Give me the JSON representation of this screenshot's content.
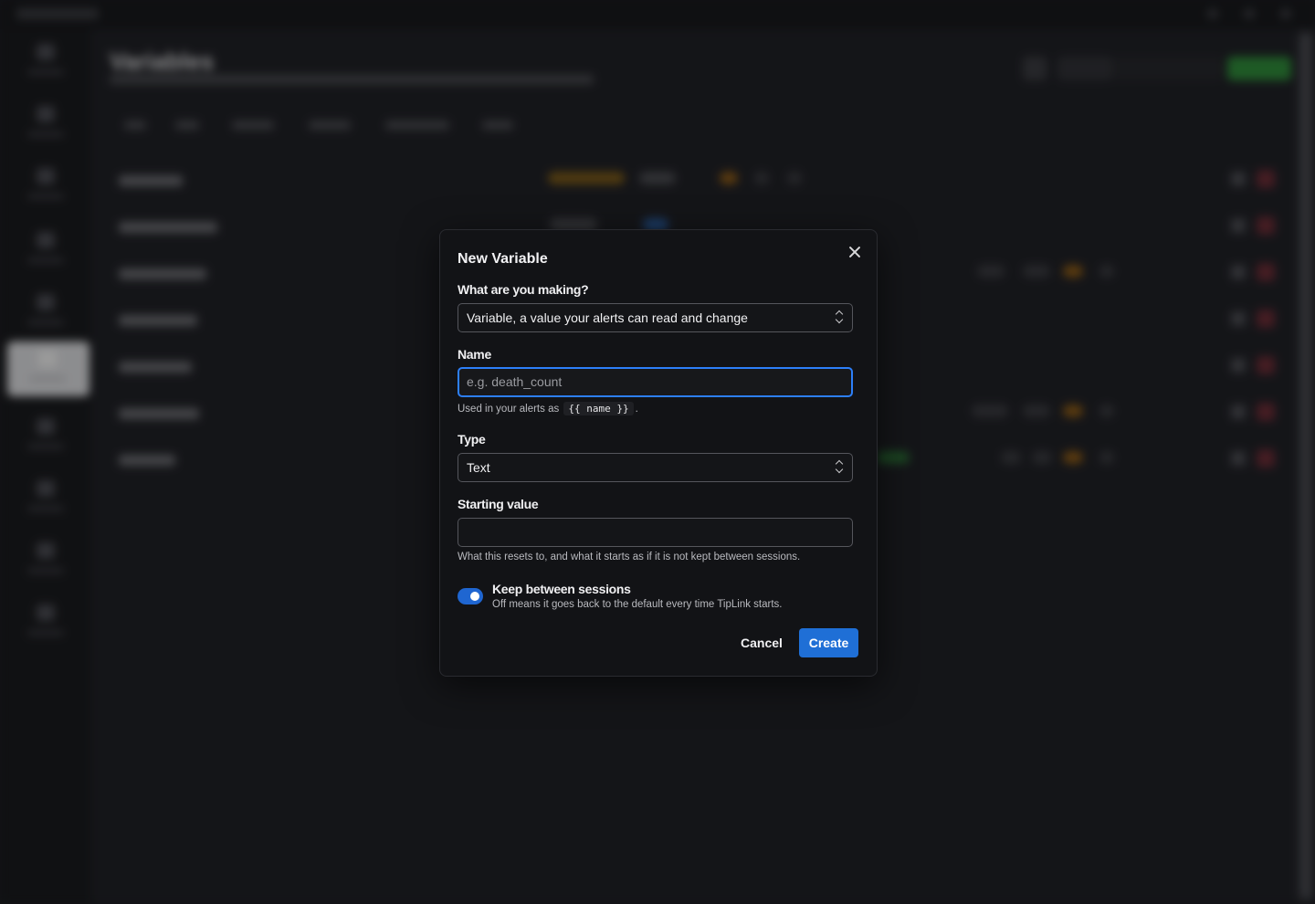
{
  "background": {
    "page_title": "Variables",
    "sidebar_count": 10,
    "active_sidebar_index": 5,
    "rows": 7
  },
  "dialog": {
    "title": "New Variable",
    "kind": {
      "label": "What are you making?",
      "value": "Variable, a value your alerts can read and change"
    },
    "name": {
      "label": "Name",
      "placeholder": "e.g. death_count",
      "value": "",
      "help_prefix": "Used in your alerts as",
      "help_code": "{{ name }}",
      "help_suffix": "."
    },
    "type": {
      "label": "Type",
      "value": "Text"
    },
    "starting_value": {
      "label": "Starting value",
      "value": "",
      "help": "What this resets to, and what it starts as if it is not kept between sessions."
    },
    "keep_sessions": {
      "label": "Keep between sessions",
      "description": "Off means it goes back to the default every time TipLink starts.",
      "enabled": true
    },
    "cancel_label": "Cancel",
    "create_label": "Create"
  },
  "colors": {
    "accent": "#1f6fd6",
    "focus_ring": "#2d7ff9",
    "dialog_bg": "#121316"
  }
}
